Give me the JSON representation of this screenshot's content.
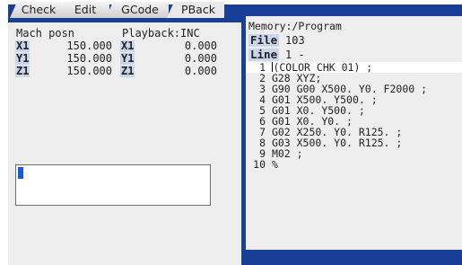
{
  "tabs": [
    {
      "label": "Check",
      "active": false
    },
    {
      "label": "Edit",
      "active": false
    },
    {
      "label": "GCode",
      "active": false
    },
    {
      "label": "PBack",
      "active": true
    }
  ],
  "position": {
    "left_header": "Mach posn",
    "right_header": "Playback:INC",
    "rows": [
      {
        "axis": "X1",
        "mach": "150.000",
        "pb_axis": "X1",
        "pb": "0.000"
      },
      {
        "axis": "Y1",
        "mach": "150.000",
        "pb_axis": "Y1",
        "pb": "0.000"
      },
      {
        "axis": "Z1",
        "mach": "150.000",
        "pb_axis": "Z1",
        "pb": "0.000"
      }
    ]
  },
  "editor": {
    "memory_label": "Memory:/Program",
    "file_label": "File",
    "file_value": "103",
    "line_label": "Line",
    "line_value": "1 -",
    "lines": [
      {
        "no": "1",
        "text": "(COLOR CHK 01) ;"
      },
      {
        "no": "2",
        "text": "G28 XYZ;"
      },
      {
        "no": "3",
        "text": "G90 G00 X500. Y0. F2000 ;"
      },
      {
        "no": "4",
        "text": "G01 X500. Y500. ;"
      },
      {
        "no": "5",
        "text": "G01 X0. Y500. ;"
      },
      {
        "no": "6",
        "text": "G01 X0. Y0. ;"
      },
      {
        "no": "7",
        "text": "G02 X250. Y0. R125. ;"
      },
      {
        "no": "8",
        "text": "G03 X500. Y0. R125. ;"
      },
      {
        "no": "9",
        "text": "M02 ;"
      },
      {
        "no": "10",
        "text": "%"
      }
    ]
  },
  "colors": {
    "bar_blue": "#1a3f96",
    "axis_highlight": "#c9d6ec",
    "cursor_blue": "#1a5ad6",
    "panel_bg": "#eeeeee"
  }
}
